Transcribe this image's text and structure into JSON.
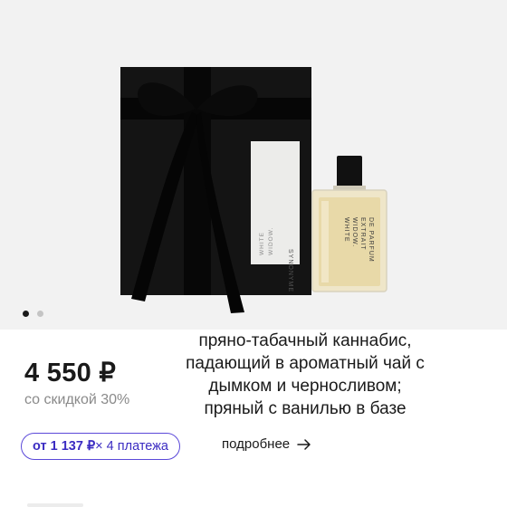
{
  "gallery": {
    "image_alt": "White Widow Extrait de Parfum — box and bottle",
    "box_label": {
      "line1": "WHITE",
      "line2": "WIDOW.",
      "brand": "SYNONYME"
    },
    "bottle_label": {
      "line1": "WHITE",
      "line2": "WIDOW.",
      "line3": "EXTRAIT",
      "line4": "DE PARFUM"
    },
    "slide_count": 2,
    "active_slide": 1
  },
  "caption": {
    "lines": [
      "пряно-табачный каннабис,",
      "падающий в ароматный чай с",
      "дымком и черносливом;",
      "пряный с ванилью в базе"
    ]
  },
  "price": {
    "value": "4 550 ₽",
    "discount_text": "со скидкой 30%"
  },
  "installments": {
    "amount": "от 1 137 ₽",
    "count": " × 4 платежа",
    "details_label": "подробнее"
  },
  "colors": {
    "accent": "#5b49d9",
    "text": "#1a1a1a",
    "muted": "#8a8a8a",
    "gallery_bg": "#f2f2f2"
  }
}
